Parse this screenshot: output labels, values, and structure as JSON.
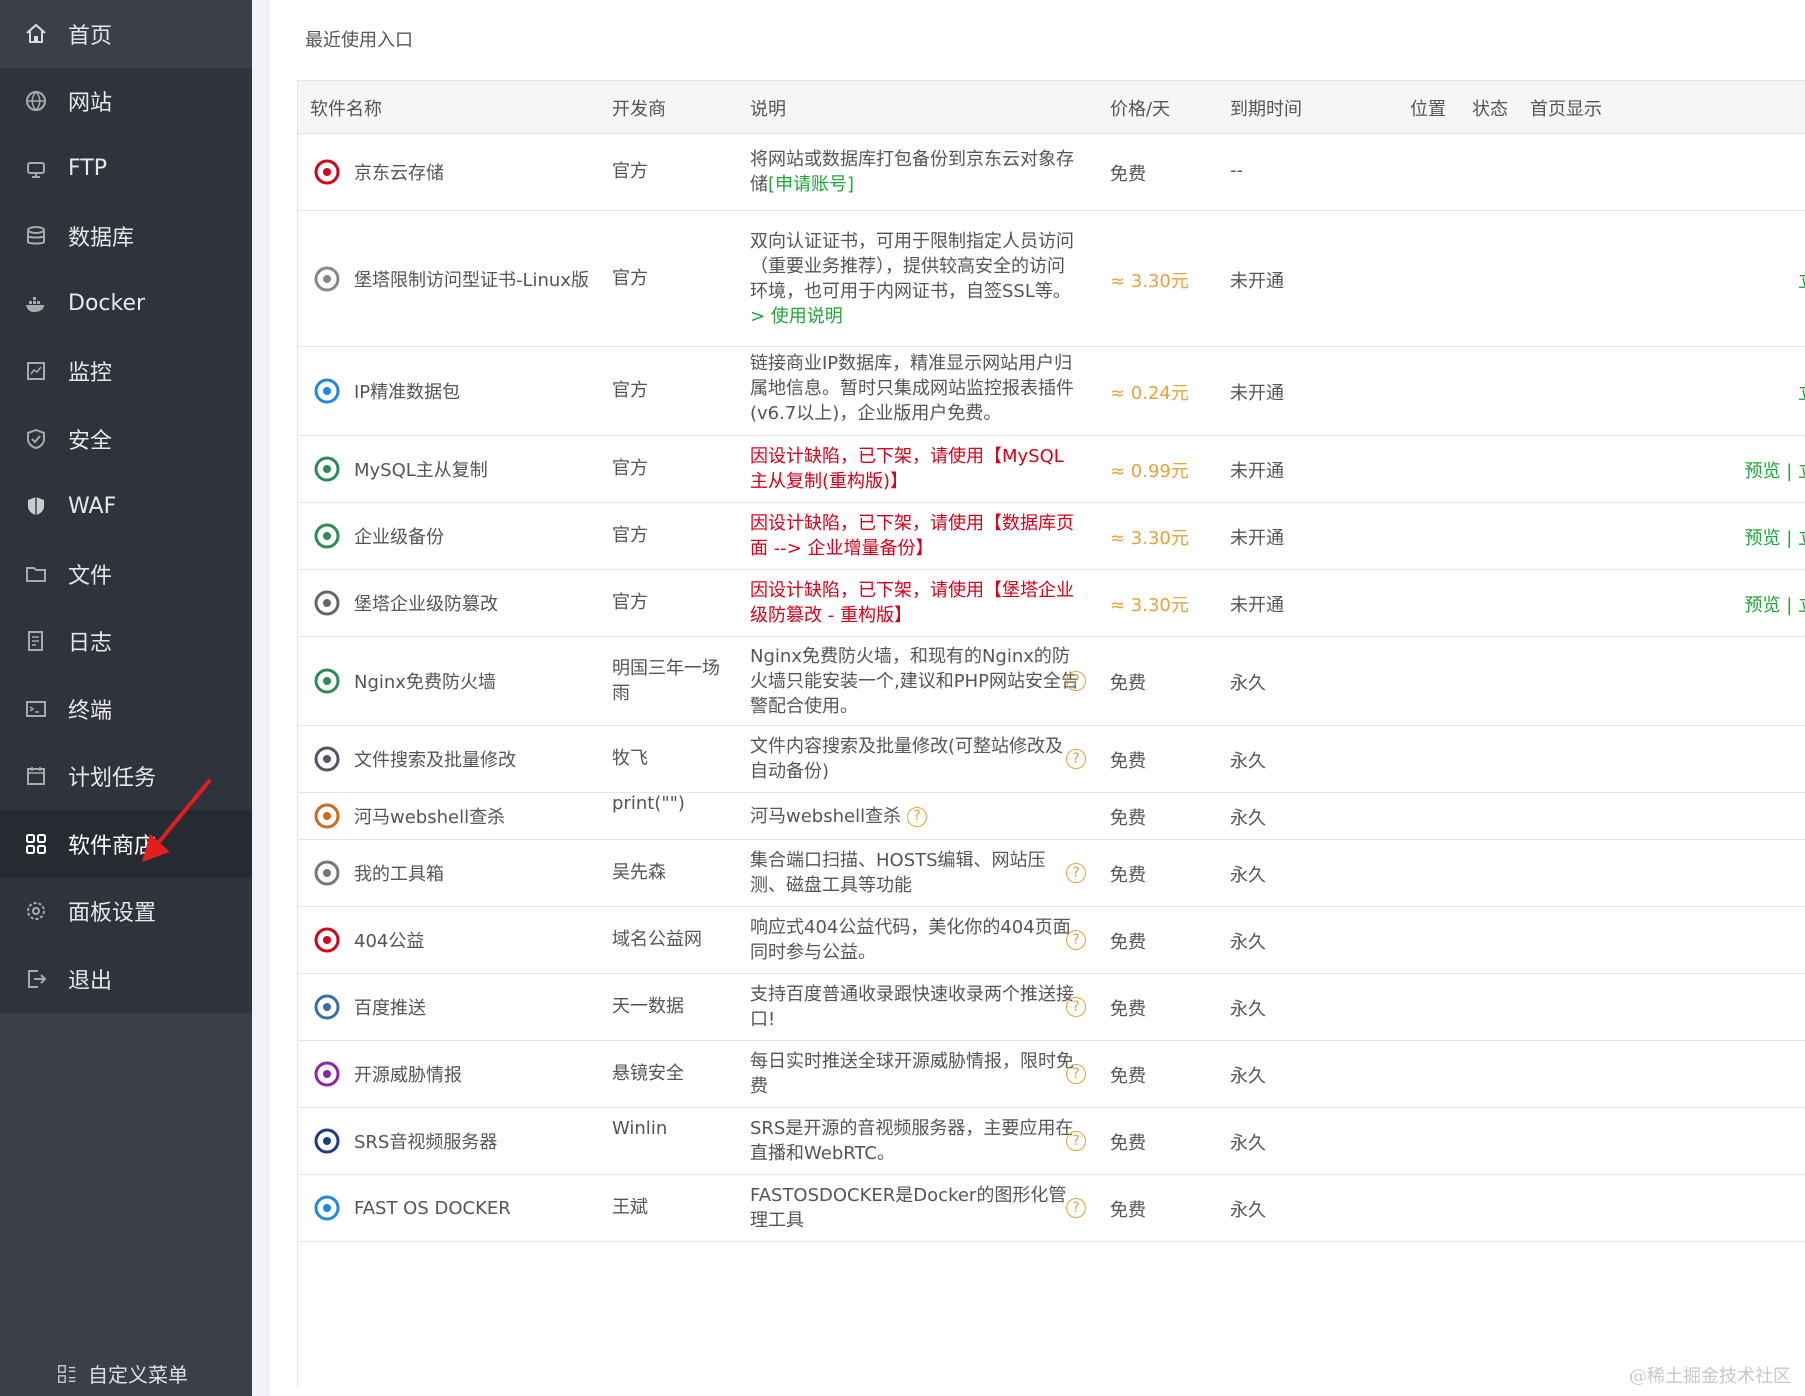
{
  "sidebar": {
    "items": [
      {
        "label": "首页",
        "icon": "home-icon"
      },
      {
        "label": "网站",
        "icon": "globe-icon"
      },
      {
        "label": "FTP",
        "icon": "ftp-icon"
      },
      {
        "label": "数据库",
        "icon": "database-icon"
      },
      {
        "label": "Docker",
        "icon": "docker-icon"
      },
      {
        "label": "监控",
        "icon": "monitor-icon"
      },
      {
        "label": "安全",
        "icon": "shield-icon"
      },
      {
        "label": "WAF",
        "icon": "waf-shield-icon"
      },
      {
        "label": "文件",
        "icon": "folder-icon"
      },
      {
        "label": "日志",
        "icon": "log-icon"
      },
      {
        "label": "终端",
        "icon": "terminal-icon"
      },
      {
        "label": "计划任务",
        "icon": "calendar-icon"
      },
      {
        "label": "软件商店",
        "icon": "grid-apps-icon"
      },
      {
        "label": "面板设置",
        "icon": "gear-icon"
      },
      {
        "label": "退出",
        "icon": "logout-icon"
      }
    ],
    "active_index": 12,
    "custom_menu_label": "自定义菜单"
  },
  "main": {
    "recent_title": "最近使用入口",
    "headers": {
      "name": "软件名称",
      "developer": "开发商",
      "desc": "说明",
      "price": "价格/天",
      "expire": "到期时间",
      "position": "位置",
      "status": "状态",
      "home_show": "首页显示"
    },
    "rows": [
      {
        "name": "京东云存储",
        "icon": "jdcloud-icon",
        "developer": "官方",
        "desc": "将网站或数据库打包备份到京东云对象存储",
        "desc_link": "[申请账号]",
        "price": "免费",
        "expire": "--",
        "ops": ""
      },
      {
        "name": "堡塔限制访问型证书-Linux版",
        "icon": "certificate-icon",
        "developer": "官方",
        "desc": "双向认证证书，可用于限制指定人员访问（重要业务推荐），提供较高安全的访问环境，也可用于内网证书，自签SSL等。",
        "desc_link": "> 使用说明",
        "price": "≈ 3.30元",
        "expire": "未开通",
        "ops": "立即"
      },
      {
        "name": "IP精准数据包",
        "icon": "ip-location-icon",
        "developer": "官方",
        "desc": "链接商业IP数据库，精准显示网站用户归属地信息。暂时只集成网站监控报表插件(v6.7以上)，企业版用户免费。",
        "desc_link": "",
        "price": "≈ 0.24元",
        "expire": "未开通",
        "ops": "立即"
      },
      {
        "name": "MySQL主从复制",
        "icon": "cloud-sync-icon",
        "developer": "官方",
        "desc": "因设计缺陷，已下架，请使用【MySQL主从复制(重构版)】",
        "desc_red": true,
        "price": "≈ 0.99元",
        "expire": "未开通",
        "ops": "预览 | 立即"
      },
      {
        "name": "企业级备份",
        "icon": "backup-icon",
        "developer": "官方",
        "desc": "因设计缺陷，已下架，请使用【数据库页面 --> 企业增量备份】",
        "desc_red": true,
        "price": "≈ 3.30元",
        "expire": "未开通",
        "ops": "预览 | 立即"
      },
      {
        "name": "堡塔企业级防篡改",
        "icon": "tamper-proof-icon",
        "developer": "官方",
        "desc": "因设计缺陷，已下架，请使用【堡塔企业级防篡改 - 重构版】",
        "desc_red": true,
        "price": "≈ 3.30元",
        "expire": "未开通",
        "ops": "预览 | 立即"
      },
      {
        "name": "Nginx免费防火墙",
        "icon": "waf-badge-icon",
        "developer": "明国三年一场雨",
        "desc": "Nginx免费防火墙，和现有的Nginx的防火墙只能安装一个,建议和PHP网站安全告警配合使用。",
        "help": true,
        "price": "免费",
        "expire": "永久",
        "ops": ""
      },
      {
        "name": "文件搜索及批量修改",
        "icon": "file-search-icon",
        "developer": "牧飞",
        "desc": "文件内容搜索及批量修改(可整站修改及自动备份)",
        "help": true,
        "price": "免费",
        "expire": "永久",
        "ops": ""
      },
      {
        "name": "河马webshell查杀",
        "icon": "hippo-icon",
        "developer": "print(\"\")",
        "desc": "河马webshell查杀",
        "help_inline": true,
        "price": "免费",
        "expire": "永久",
        "ops": ""
      },
      {
        "name": "我的工具箱",
        "icon": "tools-icon",
        "developer": "吴先森",
        "desc": "集合端口扫描、HOSTS编辑、网站压测、磁盘工具等功能",
        "help": true,
        "price": "免费",
        "expire": "永久",
        "ops": ""
      },
      {
        "name": "404公益",
        "icon": "heart-icon",
        "developer": "域名公益网",
        "desc": "响应式404公益代码，美化你的404页面同时参与公益。",
        "help": true,
        "price": "免费",
        "expire": "永久",
        "ops": ""
      },
      {
        "name": "百度推送",
        "icon": "baidu-push-icon",
        "developer": "天一数据",
        "desc": "支持百度普通收录跟快速收录两个推送接口!",
        "help": true,
        "price": "免费",
        "expire": "永久",
        "ops": ""
      },
      {
        "name": "开源威胁情报",
        "icon": "threat-intel-icon",
        "developer": "悬镜安全",
        "desc": "每日实时推送全球开源威胁情报，限时免费",
        "help": true,
        "price": "免费",
        "expire": "永久",
        "ops": ""
      },
      {
        "name": "SRS音视频服务器",
        "icon": "infinity-icon",
        "developer": "Winlin",
        "desc": "SRS是开源的音视频服务器，主要应用在直播和WebRTC。",
        "help": true,
        "price": "免费",
        "expire": "永久",
        "ops": ""
      },
      {
        "name": "FAST OS DOCKER",
        "icon": "docker-fastos-icon",
        "developer": "王斌",
        "desc": "FASTOSDOCKER是Docker的图形化管理工具",
        "help": true,
        "price": "免费",
        "expire": "永久",
        "ops": ""
      }
    ]
  },
  "help_glyph": "?",
  "watermark": "@稀土掘金技术社区",
  "colors": {
    "accent_green": "#20a53a",
    "warning_orange": "#e6a23c",
    "danger_red": "#d9001b",
    "sidebar_bg": "#3a3f4a"
  }
}
